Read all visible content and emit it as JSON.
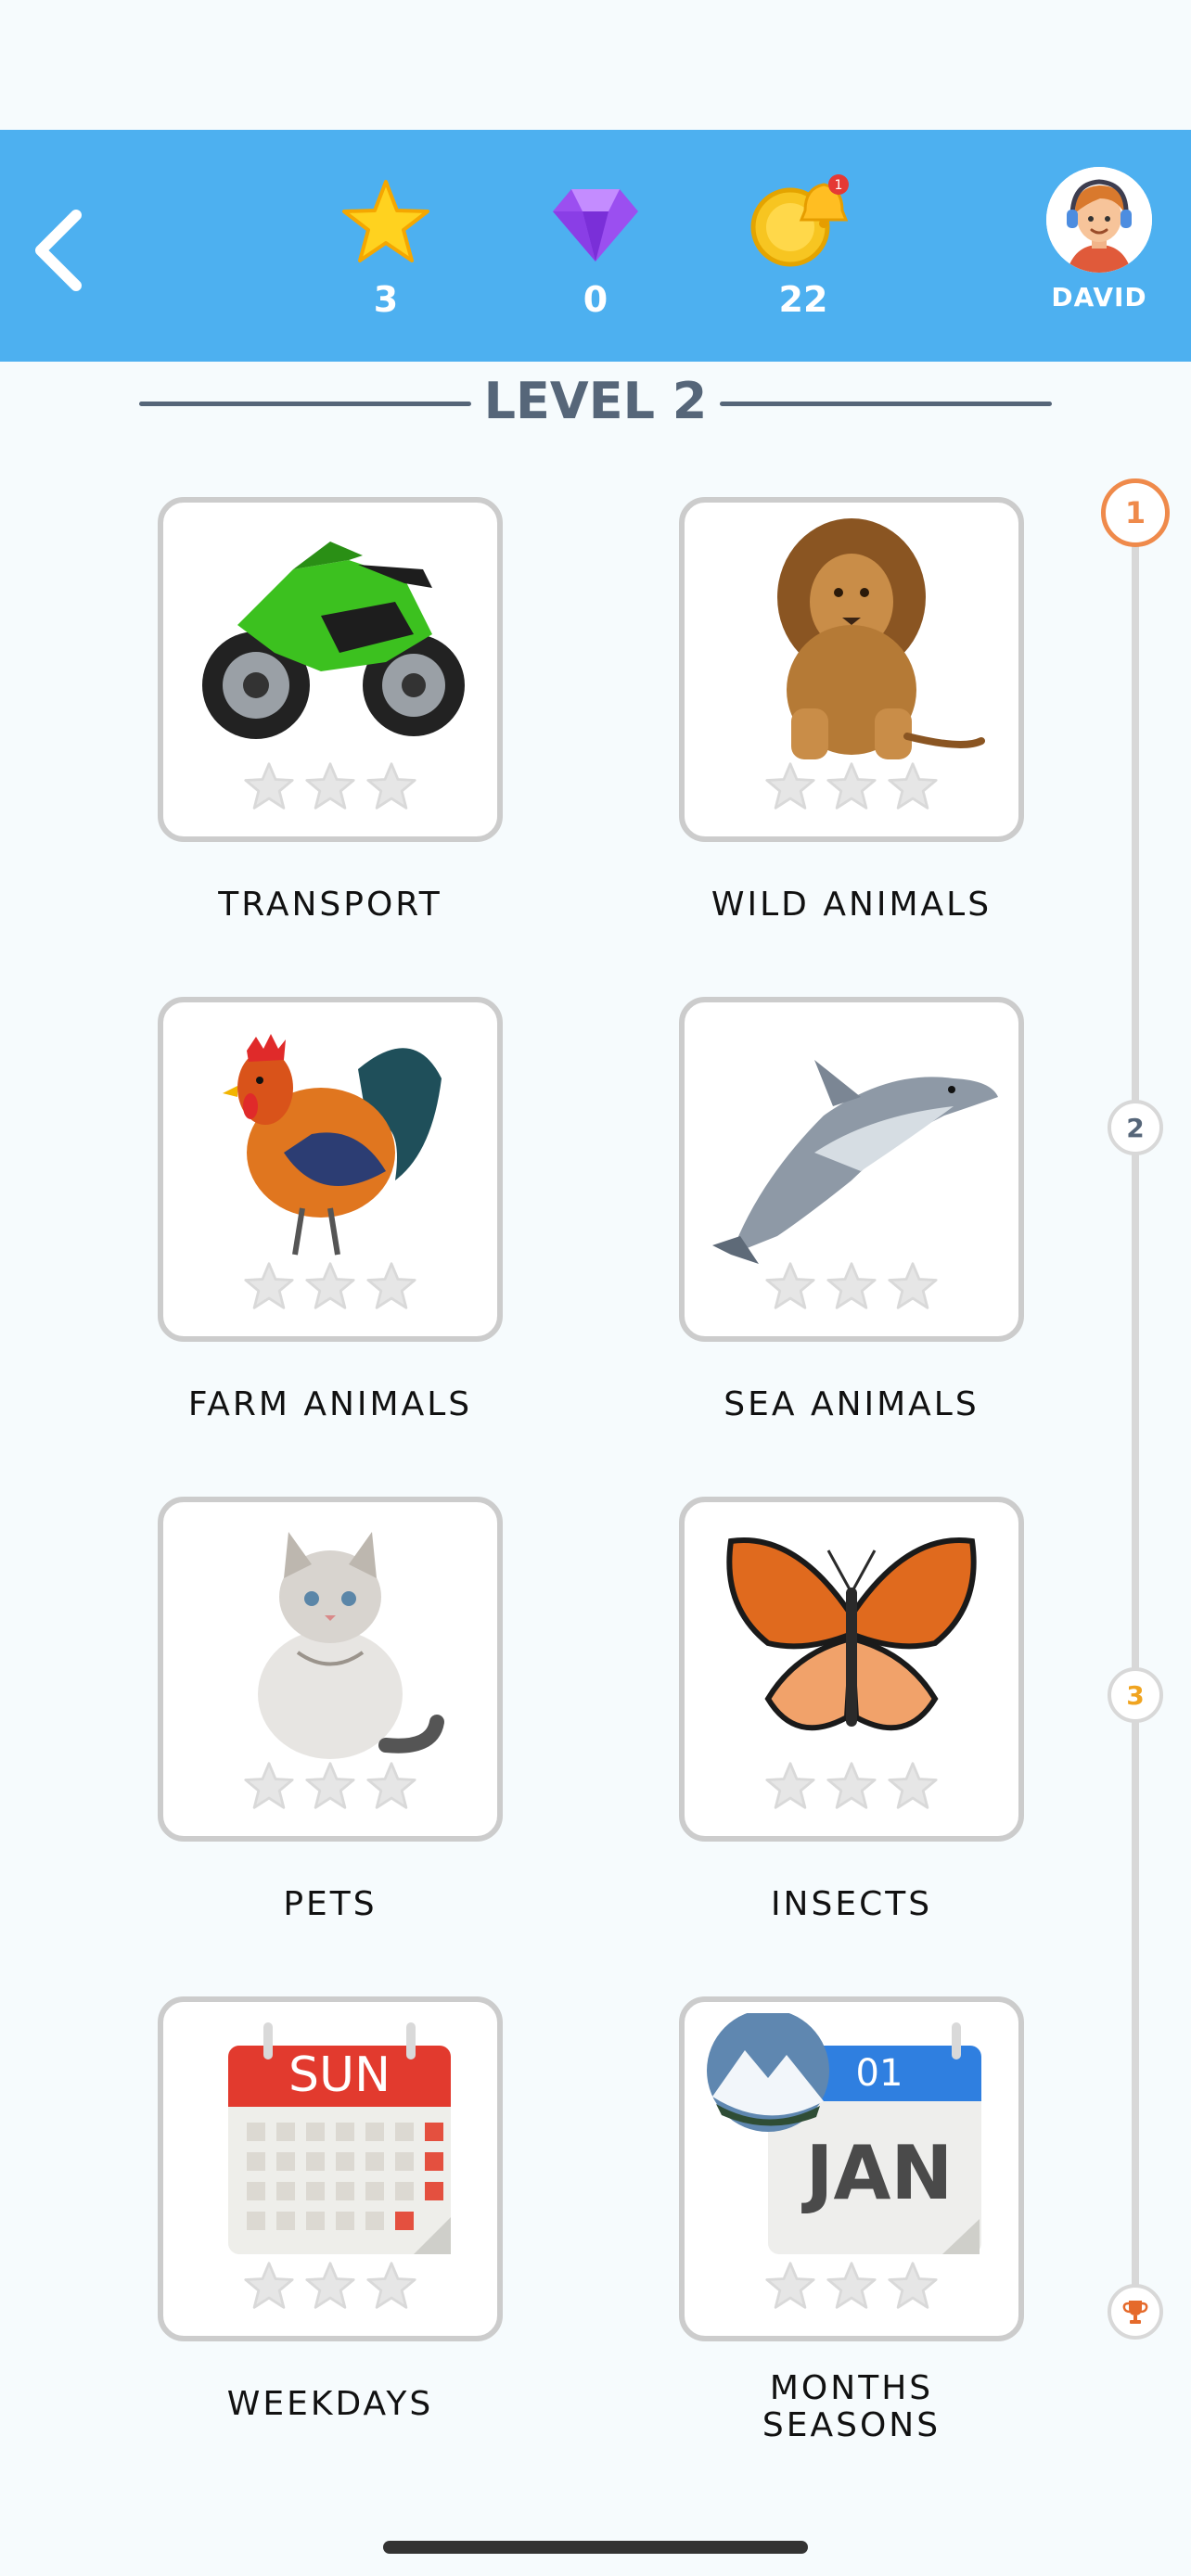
{
  "header": {
    "stars": {
      "icon": "star-icon",
      "value": "3"
    },
    "gems": {
      "icon": "gem-icon",
      "value": "0"
    },
    "coins": {
      "icon": "coin-bell-icon",
      "value": "22",
      "badge": "1"
    },
    "profile": {
      "name": "DAVID"
    }
  },
  "level": {
    "title": "LEVEL 2"
  },
  "categories": [
    {
      "label": "TRANSPORT",
      "image": "motorcycle",
      "stars_earned": 0,
      "stars_total": 3
    },
    {
      "label": "WILD ANIMALS",
      "image": "lion",
      "stars_earned": 0,
      "stars_total": 3
    },
    {
      "label": "FARM ANIMALS",
      "image": "rooster",
      "stars_earned": 0,
      "stars_total": 3
    },
    {
      "label": "SEA ANIMALS",
      "image": "dolphin",
      "stars_earned": 0,
      "stars_total": 3
    },
    {
      "label": "PETS",
      "image": "cat",
      "stars_earned": 0,
      "stars_total": 3
    },
    {
      "label": "INSECTS",
      "image": "butterfly",
      "stars_earned": 0,
      "stars_total": 3
    },
    {
      "label": "WEEKDAYS",
      "image": "calendar",
      "calendar_text": "SUN",
      "stars_earned": 0,
      "stars_total": 3
    },
    {
      "label_line1": "MONTHS",
      "label_line2": "SEASONS",
      "image": "month-calendar",
      "calendar_day": "01",
      "calendar_month": "JAN",
      "stars_earned": 0,
      "stars_total": 3
    }
  ],
  "progress": {
    "nodes": [
      {
        "label": "1",
        "state": "current"
      },
      {
        "label": "2",
        "state": "locked"
      },
      {
        "label": "3",
        "state": "next"
      },
      {
        "icon": "trophy-icon",
        "state": "goal"
      }
    ]
  },
  "colors": {
    "header_bg": "#4db0f0",
    "page_bg": "#f6fbfd",
    "accent_orange": "#ef8a4b",
    "title_gray": "#566679",
    "card_border": "#cccccc"
  }
}
